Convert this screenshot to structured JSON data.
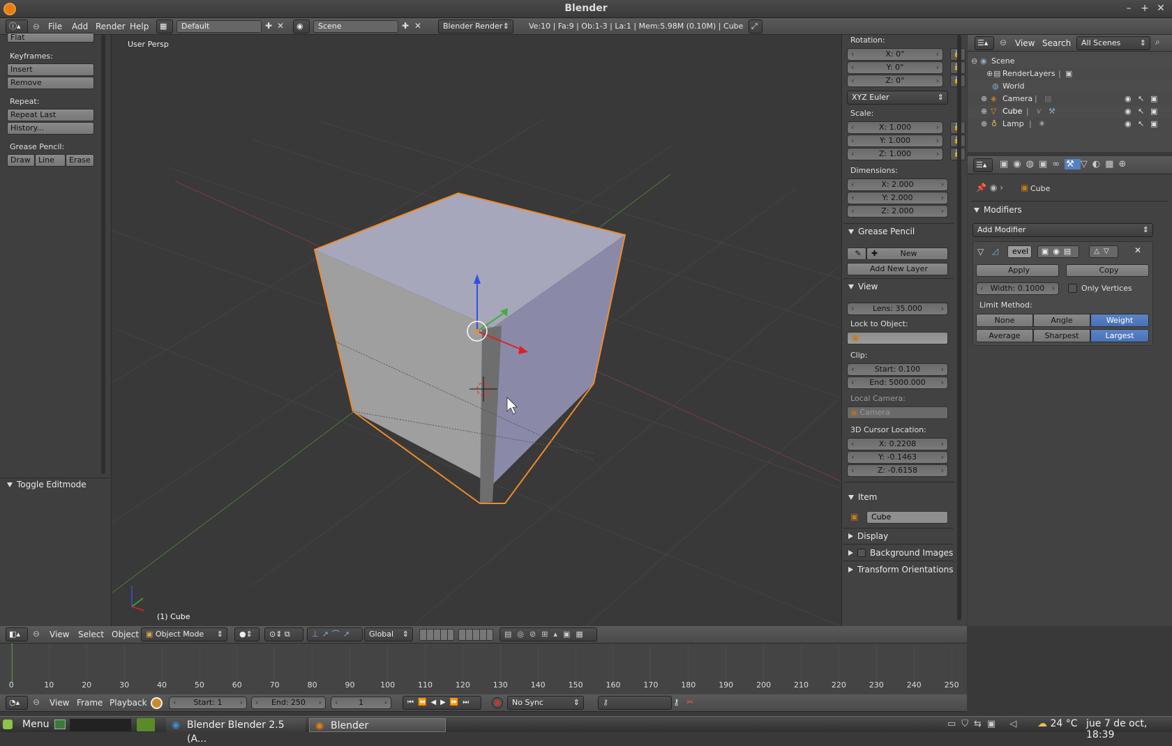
{
  "window": {
    "title": "Blender",
    "minimize": "–",
    "maximize": "+",
    "close": "✕"
  },
  "info_header": {
    "menus": [
      "File",
      "Add",
      "Render",
      "Help"
    ],
    "layout": "Default",
    "scene": "Scene",
    "engine": "Blender Render",
    "stats": "Ve:10 | Fa:9 | Ob:1-3 | La:1 | Mem:5.98M (0.10M) | Cube"
  },
  "toolshelf": {
    "flat_label": "Flat",
    "keyframes_label": "Keyframes:",
    "insert": "Insert",
    "remove": "Remove",
    "repeat_label": "Repeat:",
    "repeat_last": "Repeat Last",
    "history": "History...",
    "grease_label": "Grease Pencil:",
    "draw": "Draw",
    "line": "Line",
    "erase": "Erase",
    "toggle_editmode": "Toggle Editmode"
  },
  "viewport": {
    "view_name": "User Persp",
    "object_label": "(1) Cube"
  },
  "properties_n": {
    "rotation_label": "Rotation:",
    "rot_x": "X: 0°",
    "rot_y": "Y: 0°",
    "rot_z": "Z: 0°",
    "rotation_mode": "XYZ Euler",
    "scale_label": "Scale:",
    "scale_x": "X: 1.000",
    "scale_y": "Y: 1.000",
    "scale_z": "Z: 1.000",
    "dimensions_label": "Dimensions:",
    "dim_x": "X: 2.000",
    "dim_y": "Y: 2.000",
    "dim_z": "Z: 2.000",
    "grease_panel": "Grease Pencil",
    "gp_new": "New",
    "add_new_layer": "Add New Layer",
    "view_panel": "View",
    "lens": "Lens: 35.000",
    "lock_to_object": "Lock to Object:",
    "clip_label": "Clip:",
    "clip_start": "Start: 0.100",
    "clip_end": "End: 5000.000",
    "local_camera_label": "Local Camera:",
    "local_camera": "Camera",
    "cursor_label": "3D Cursor Location:",
    "cursor_x": "X: 0.2208",
    "cursor_y": "Y: -0.1463",
    "cursor_z": "Z: -0.6158",
    "item_panel": "Item",
    "item_name": "Cube",
    "display_panel": "Display",
    "bg_images_panel": "Background Images",
    "transform_orient_panel": "Transform Orientations"
  },
  "outliner": {
    "menus": [
      "View",
      "Search"
    ],
    "filter": "All Scenes",
    "items": [
      {
        "label": "Scene",
        "icon": "scene-icon"
      },
      {
        "label": "RenderLayers",
        "icon": "renderlayers-icon"
      },
      {
        "label": "World",
        "icon": "world-icon"
      },
      {
        "label": "Camera",
        "icon": "camera-icon"
      },
      {
        "label": "Cube",
        "icon": "mesh-icon"
      },
      {
        "label": "Lamp",
        "icon": "lamp-icon"
      }
    ]
  },
  "properties_editor": {
    "context_object": "Cube",
    "modifiers_panel": "Modifiers",
    "add_modifier": "Add Modifier",
    "modifier_name": "evel",
    "apply": "Apply",
    "copy": "Copy",
    "width": "Width: 0.1000",
    "only_vertices": "Only Vertices",
    "limit_method": "Limit Method:",
    "limit_options": [
      "None",
      "Angle",
      "Weight"
    ],
    "width_options": [
      "Average",
      "Sharpest",
      "Largest"
    ]
  },
  "view3d_header": {
    "menus": [
      "View",
      "Select",
      "Object"
    ],
    "mode": "Object Mode",
    "orientation": "Global"
  },
  "timeline": {
    "ticks": [
      "0",
      "10",
      "20",
      "30",
      "40",
      "50",
      "60",
      "70",
      "80",
      "90",
      "100",
      "110",
      "120",
      "130",
      "140",
      "150",
      "160",
      "170",
      "180",
      "190",
      "200",
      "210",
      "220",
      "230",
      "240",
      "250"
    ],
    "menus": [
      "View",
      "Frame",
      "Playback"
    ],
    "start": "Start: 1",
    "end": "End: 250",
    "current": "1",
    "sync": "No Sync"
  },
  "taskbar": {
    "menu": "Menu",
    "task1": "Blender Blender 2.5 (A...",
    "task2": "Blender",
    "temp": "24 °C",
    "clock": "jue  7 de oct, 18:39"
  },
  "colors": {
    "accent": "#5680c2",
    "selection_outline": "#f08b2a",
    "bg_dark": "#393939"
  }
}
